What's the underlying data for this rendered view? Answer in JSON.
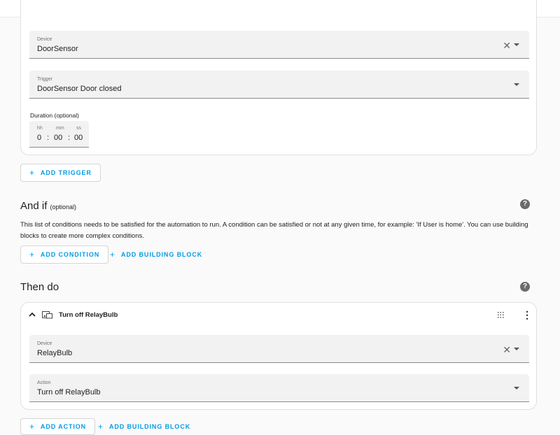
{
  "trigger_card": {
    "device_field": {
      "label": "Device",
      "value": "DoorSensor"
    },
    "trigger_field": {
      "label": "Trigger",
      "value": "DoorSensor Door closed"
    },
    "duration": {
      "label": "Duration (optional)",
      "units": {
        "hh": "hh",
        "mm": "mm",
        "ss": "ss"
      },
      "values": {
        "hh": "0",
        "mm": "00",
        "ss": "00"
      },
      "sep": ":"
    }
  },
  "add_trigger_label": "ADD TRIGGER",
  "conditions": {
    "title": "And if",
    "optional": "(optional)",
    "description": "This list of conditions needs to be satisfied for the automation to run. A condition can be satisfied or not at any given time, for example: 'If User is home'. You can use building blocks to create more complex conditions.",
    "add_condition_label": "ADD CONDITION",
    "add_building_block_label": "ADD BUILDING BLOCK"
  },
  "actions": {
    "title": "Then do",
    "card": {
      "title": "Turn off RelayBulb",
      "device_field": {
        "label": "Device",
        "value": "RelayBulb"
      },
      "action_field": {
        "label": "Action",
        "value": "Turn off RelayBulb"
      }
    },
    "add_action_label": "ADD ACTION",
    "add_building_block_label": "ADD BUILDING BLOCK"
  },
  "icons": {
    "help": "?",
    "clear": "✕",
    "plus": "+",
    "more": "⋮"
  },
  "colors": {
    "accent": "#039be5",
    "field_bg": "#f2f2f2",
    "card_border": "#e0e0e0"
  }
}
